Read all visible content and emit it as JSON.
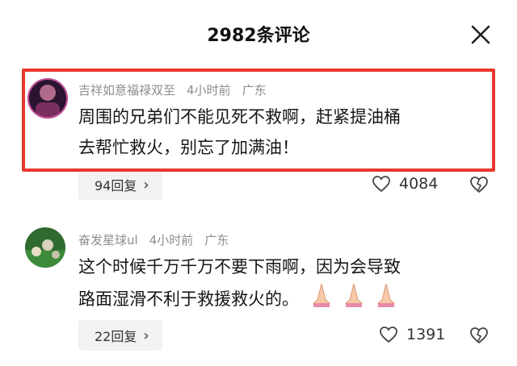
{
  "header": {
    "title": "2982条评论",
    "close_icon": "close-icon"
  },
  "comments": [
    {
      "user": "吉祥如意福禄双至",
      "time": "4小时前",
      "location": "广东",
      "lines": [
        "周围的兄弟们不能见死不救啊，赶紧提油桶",
        "去帮忙救火，别忘了加满油！"
      ],
      "replies": "94回复",
      "likes": "4084",
      "highlight_color": "#e8372c"
    },
    {
      "user": "奋发星球ul",
      "time": "4小时前",
      "location": "广东",
      "lines": [
        "这个时候千万千万不要下雨啊，因为会导致",
        "路面湿滑不利于救援救火的。"
      ],
      "emoji": "folded-hands-icon ×3",
      "replies": "22回复",
      "likes": "1391"
    }
  ]
}
